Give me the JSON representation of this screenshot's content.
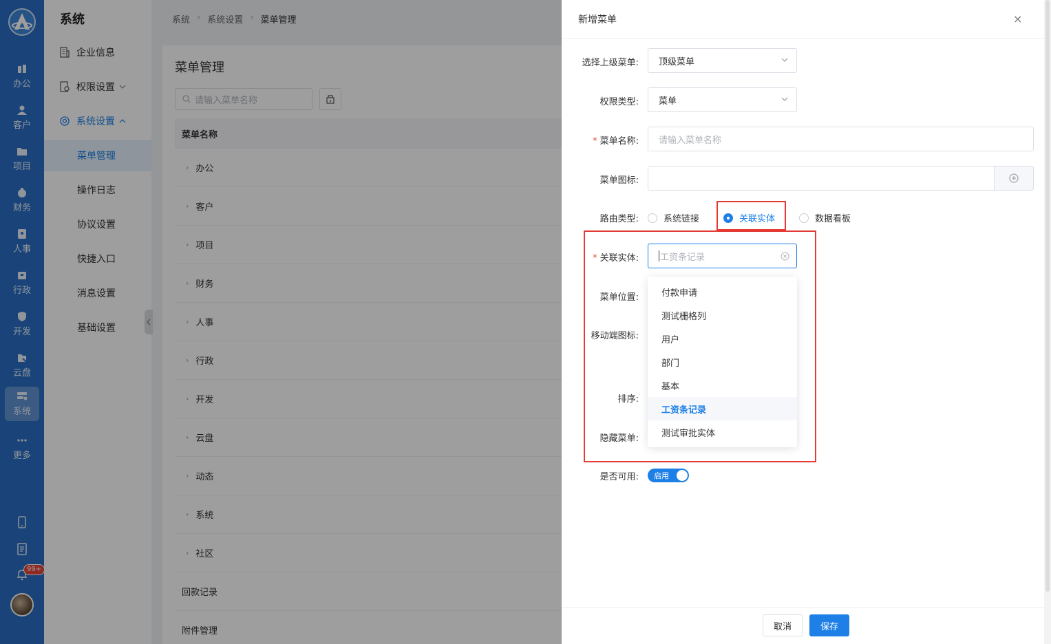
{
  "rail": {
    "items": [
      {
        "label": "办公",
        "icon": "office-icon"
      },
      {
        "label": "客户",
        "icon": "customer-icon"
      },
      {
        "label": "项目",
        "icon": "project-icon"
      },
      {
        "label": "财务",
        "icon": "finance-icon"
      },
      {
        "label": "人事",
        "icon": "hr-icon"
      },
      {
        "label": "行政",
        "icon": "admin-icon"
      },
      {
        "label": "开发",
        "icon": "dev-icon"
      },
      {
        "label": "云盘",
        "icon": "cloud-icon"
      },
      {
        "label": "系统",
        "icon": "system-icon"
      },
      {
        "label": "更多",
        "icon": "more-icon"
      }
    ],
    "notification_badge": "99+"
  },
  "sidebar": {
    "title": "系统",
    "items": [
      {
        "label": "企业信息"
      },
      {
        "label": "权限设置"
      },
      {
        "label": "系统设置"
      }
    ],
    "sub_items": [
      {
        "label": "菜单管理"
      },
      {
        "label": "操作日志"
      },
      {
        "label": "协议设置"
      },
      {
        "label": "快捷入口"
      },
      {
        "label": "消息设置"
      },
      {
        "label": "基础设置"
      }
    ]
  },
  "breadcrumb": [
    "系统",
    "系统设置",
    "菜单管理"
  ],
  "main": {
    "title": "菜单管理",
    "search_placeholder": "请输入菜单名称",
    "column_header": "菜单名称",
    "rows": [
      "办公",
      "客户",
      "项目",
      "财务",
      "人事",
      "行政",
      "开发",
      "云盘",
      "动态",
      "系统",
      "社区"
    ],
    "plain_rows": [
      "回款记录",
      "附件管理"
    ]
  },
  "drawer": {
    "title": "新增菜单",
    "close_glyph": "×",
    "labels": {
      "parent": "选择上级菜单:",
      "perm_type": "权限类型:",
      "name": "菜单名称:",
      "icon": "菜单图标:",
      "route_type": "路由类型:",
      "entity": "关联实体:",
      "position": "菜单位置:",
      "mobile_icon": "移动端图标:",
      "sort": "排序:",
      "hidden": "隐藏菜单:",
      "enabled": "是否可用:"
    },
    "required_mark": "*",
    "parent_value": "顶级菜单",
    "perm_type_value": "菜单",
    "name_placeholder": "请输入菜单名称",
    "route_options": [
      "系统链接",
      "关联实体",
      "数据看板"
    ],
    "entity_placeholder": "工资条记录",
    "entity_options": [
      "付款申请",
      "测试栅格列",
      "用户",
      "部门",
      "基本",
      "工资条记录",
      "测试审批实体"
    ],
    "switch_label": "启用",
    "cancel_label": "取消",
    "save_label": "保存"
  },
  "colors": {
    "primary": "#1e80e6",
    "rail": "#2a6fc4",
    "highlight": "#e53935"
  }
}
